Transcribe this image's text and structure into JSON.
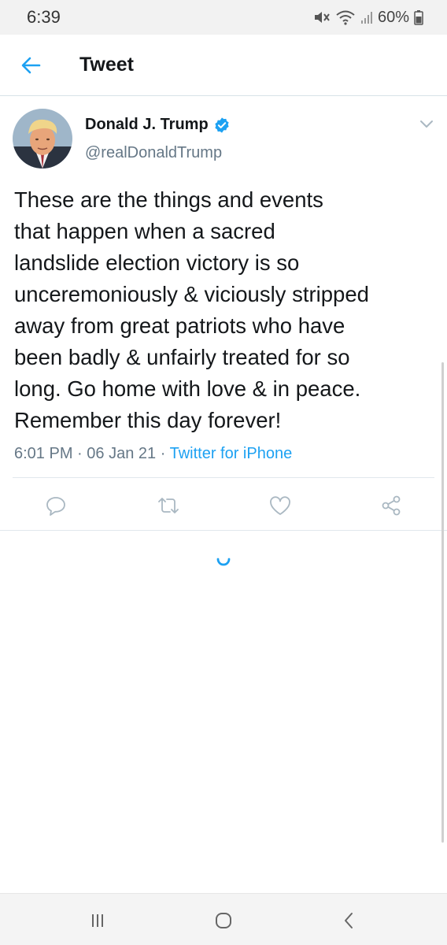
{
  "status_bar": {
    "time": "6:39",
    "battery": "60%",
    "icons": [
      "mute-icon",
      "wifi-icon",
      "signal-icon",
      "battery-icon"
    ]
  },
  "header": {
    "title": "Tweet",
    "back_icon": "arrow-left-icon"
  },
  "tweet": {
    "name": "Donald J. Trump",
    "handle": "@realDonaldTrump",
    "verified": true,
    "text_lines": [
      "These are the things and events",
      "that happen when a sacred",
      "landslide election victory is so",
      "unceremoniously & viciously stripped",
      "away from great patriots who have",
      "been badly & unfairly treated for so",
      "long. Go home with love & in peace.",
      "Remember this day forever!"
    ],
    "time": "6:01 PM",
    "separator": "·",
    "date": "06 Jan 21",
    "source": "Twitter for iPhone"
  },
  "actions": [
    "reply-icon",
    "retweet-icon",
    "like-icon",
    "share-icon"
  ],
  "nav": [
    "recent-apps-icon",
    "home-icon",
    "back-icon"
  ],
  "colors": {
    "accent": "#1da1f2",
    "secondary_text": "#657786",
    "primary_text": "#14171a",
    "icon_gray": "#aab8c2"
  }
}
